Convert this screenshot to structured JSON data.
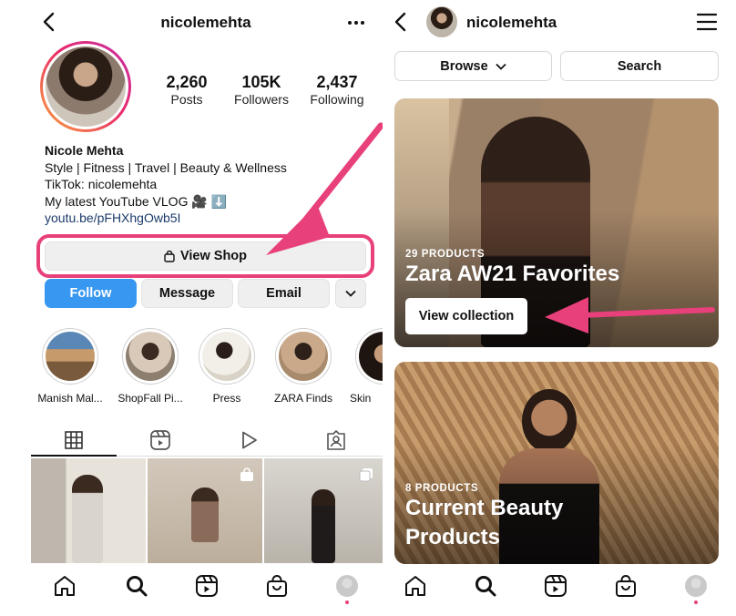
{
  "left": {
    "header": {
      "username": "nicolemehta"
    },
    "stats": [
      {
        "value": "2,260",
        "label": "Posts"
      },
      {
        "value": "105K",
        "label": "Followers"
      },
      {
        "value": "2,437",
        "label": "Following"
      }
    ],
    "bio": {
      "name": "Nicole Mehta",
      "line1": "Style | Fitness | Travel | Beauty & Wellness",
      "line2": "TikTok: nicolemehta",
      "line3": "My latest YouTube VLOG 🎥 ⬇️",
      "link": "youtu.be/pFHXhgOwb5I"
    },
    "view_shop_label": "View Shop",
    "buttons": {
      "follow": "Follow",
      "message": "Message",
      "email": "Email"
    },
    "highlights": [
      {
        "label": "Manish Mal..."
      },
      {
        "label": "ShopFall Pi..."
      },
      {
        "label": "Press"
      },
      {
        "label": "ZARA Finds"
      },
      {
        "label": "Skin"
      }
    ]
  },
  "right": {
    "header": {
      "username": "nicolemehta"
    },
    "browse_label": "Browse",
    "search_label": "Search",
    "collections": [
      {
        "count": "29 PRODUCTS",
        "title": "Zara AW21 Favorites",
        "button": "View collection"
      },
      {
        "count": "8 PRODUCTS",
        "title": "Current Beauty Products"
      }
    ]
  },
  "colors": {
    "accent": "#e8407a",
    "follow_blue": "#3897f0",
    "link": "#1b3a6b"
  },
  "icons": [
    "back-icon",
    "more-icon",
    "menu-icon",
    "grid-icon",
    "reels-icon",
    "play-icon",
    "tagged-icon",
    "home-icon",
    "search-icon",
    "shop-icon",
    "chevron-down-icon",
    "bag-icon"
  ]
}
